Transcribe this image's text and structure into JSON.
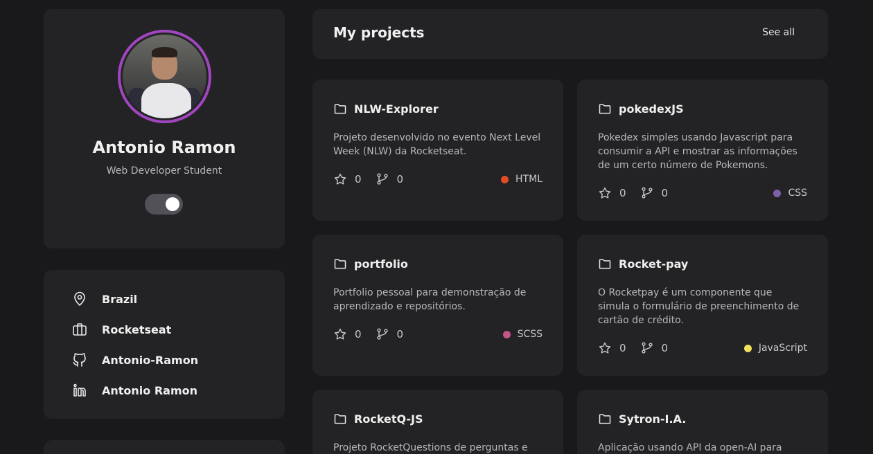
{
  "profile": {
    "name": "Antonio Ramon",
    "role": "Web Developer Student",
    "accent": "#a046c0"
  },
  "info": {
    "location": "Brazil",
    "company": "Rocketseat",
    "github": "Antonio-Ramon",
    "linkedin": "Antonio Ramon"
  },
  "projects_header": {
    "title": "My projects",
    "see_all": "See all"
  },
  "projects": [
    {
      "name": "NLW-Explorer",
      "description": "Projeto desenvolvido no evento Next Level Week (NLW) da Rocketseat.",
      "stars": "0",
      "forks": "0",
      "language": "HTML",
      "language_color": "#e34c26"
    },
    {
      "name": "pokedexJS",
      "description": "Pokedex simples usando Javascript para consumir a API e mostrar as informações de um certo número de Pokemons.",
      "stars": "0",
      "forks": "0",
      "language": "CSS",
      "language_color": "#7e61ab"
    },
    {
      "name": "portfolio",
      "description": "Portfolio pessoal para demonstração de aprendizado e repositórios.",
      "stars": "0",
      "forks": "0",
      "language": "SCSS",
      "language_color": "#c6538c"
    },
    {
      "name": "Rocket-pay",
      "description": "O Rocketpay é um componente que simula o formulário de preenchimento de cartão de crédito.",
      "stars": "0",
      "forks": "0",
      "language": "JavaScript",
      "language_color": "#f1e05a"
    },
    {
      "name": "RocketQ-JS",
      "description": "Projeto RocketQuestions de perguntas e"
    },
    {
      "name": "Sytron-I.A.",
      "description": "Aplicação usando API da open-AI para ajudar"
    }
  ]
}
